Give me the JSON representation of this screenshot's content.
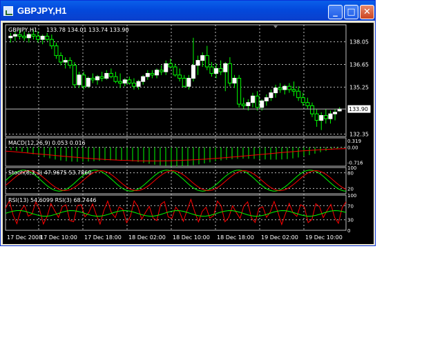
{
  "window": {
    "title": "GBPJPY,H1",
    "buttons": {
      "minimize": "_",
      "maximize": "□",
      "close": "✕"
    }
  },
  "colors": {
    "background": "#000000",
    "grid": "#C0C0C0",
    "bull_candle": "#FFFFFF",
    "wick": "#00FF00",
    "macd_histogram": "#00FF00",
    "macd_signal": "#FF0000",
    "stoch_main": "#00FF00",
    "stoch_signal": "#FF0000",
    "rsi_fast": "#FF0000",
    "rsi_slow": "#00FF00",
    "text": "#FFFFFF",
    "titlebar": "#0A5FEA"
  },
  "chart_data": [
    {
      "type": "candlestick",
      "title": "GBPJPY,H1",
      "ohlc_label": "133.78 134.01 133.74 133.90",
      "yticks": [
        "138.05",
        "136.65",
        "135.25",
        "132.35"
      ],
      "ylim": [
        132.2,
        139.1
      ],
      "current_price": 133.9,
      "current_price_label": "133.90",
      "xticks": [
        "17 Dec 2008",
        "17 Dec 10:00",
        "17 Dec 18:00",
        "18 Dec 02:00",
        "18 Dec 10:00",
        "18 Dec 18:00",
        "19 Dec 02:00",
        "19 Dec 10:00"
      ],
      "series": [
        {
          "values": [
            [
              138.3,
              138.6,
              138.0,
              138.4
            ],
            [
              138.4,
              138.7,
              138.1,
              138.5
            ],
            [
              138.5,
              138.8,
              138.2,
              138.4
            ],
            [
              138.4,
              138.7,
              138.1,
              138.3
            ],
            [
              138.3,
              138.6,
              138.0,
              138.5
            ],
            [
              138.5,
              138.8,
              138.2,
              138.4
            ],
            [
              138.4,
              138.7,
              138.0,
              138.2
            ],
            [
              138.2,
              138.5,
              137.9,
              138.4
            ],
            [
              138.4,
              138.6,
              138.1,
              138.2
            ],
            [
              138.2,
              138.5,
              137.6,
              137.8
            ],
            [
              137.8,
              138.0,
              137.0,
              137.2
            ],
            [
              137.2,
              137.4,
              136.6,
              136.8
            ],
            [
              136.8,
              137.1,
              136.4,
              136.9
            ],
            [
              136.9,
              137.1,
              136.4,
              136.6
            ],
            [
              136.6,
              136.8,
              135.2,
              135.4
            ],
            [
              135.4,
              136.2,
              135.2,
              136.0
            ],
            [
              136.0,
              136.2,
              135.1,
              135.3
            ],
            [
              135.3,
              135.9,
              135.2,
              135.8
            ],
            [
              135.8,
              136.1,
              135.5,
              135.7
            ],
            [
              135.7,
              136.0,
              135.4,
              135.9
            ],
            [
              135.9,
              136.2,
              135.6,
              135.8
            ],
            [
              135.8,
              136.3,
              135.7,
              136.1
            ],
            [
              136.1,
              136.4,
              135.8,
              135.9
            ],
            [
              135.9,
              136.2,
              135.5,
              135.6
            ],
            [
              135.6,
              136.1,
              135.2,
              135.5
            ],
            [
              135.5,
              135.8,
              135.3,
              135.7
            ],
            [
              135.7,
              135.9,
              135.4,
              135.5
            ],
            [
              135.5,
              135.8,
              135.1,
              135.3
            ],
            [
              135.3,
              135.7,
              135.1,
              135.6
            ],
            [
              135.6,
              136.0,
              135.4,
              135.9
            ],
            [
              135.9,
              136.3,
              135.7,
              136.1
            ],
            [
              136.1,
              136.3,
              135.8,
              136.0
            ],
            [
              136.0,
              136.4,
              135.8,
              136.3
            ],
            [
              136.3,
              136.6,
              136.0,
              136.2
            ],
            [
              136.2,
              136.9,
              136.0,
              136.7
            ],
            [
              136.7,
              137.0,
              136.4,
              136.5
            ],
            [
              136.5,
              136.7,
              135.9,
              136.0
            ],
            [
              136.0,
              136.4,
              135.6,
              135.8
            ],
            [
              135.8,
              136.0,
              135.2,
              135.3
            ],
            [
              135.3,
              136.0,
              135.1,
              135.8
            ],
            [
              135.8,
              138.3,
              135.6,
              136.6
            ],
            [
              136.6,
              137.2,
              136.0,
              136.9
            ],
            [
              136.9,
              137.4,
              136.5,
              137.2
            ],
            [
              137.2,
              137.8,
              136.3,
              136.5
            ],
            [
              136.5,
              136.8,
              135.9,
              136.1
            ],
            [
              136.1,
              136.7,
              135.8,
              136.4
            ],
            [
              136.4,
              136.9,
              136.0,
              136.2
            ],
            [
              136.2,
              136.8,
              135.0,
              136.7
            ],
            [
              136.7,
              137.1,
              135.3,
              135.5
            ],
            [
              135.5,
              136.0,
              135.2,
              135.8
            ],
            [
              135.8,
              136.0,
              134.0,
              134.2
            ],
            [
              134.2,
              134.6,
              133.9,
              134.1
            ],
            [
              134.1,
              134.5,
              133.8,
              134.3
            ],
            [
              134.3,
              134.9,
              134.0,
              134.7
            ],
            [
              134.7,
              135.0,
              133.8,
              134.0
            ],
            [
              134.0,
              134.5,
              133.8,
              134.4
            ],
            [
              134.4,
              134.8,
              134.1,
              134.6
            ],
            [
              134.6,
              135.1,
              134.4,
              134.9
            ],
            [
              134.9,
              135.4,
              134.6,
              135.2
            ],
            [
              135.2,
              135.5,
              134.9,
              135.1
            ],
            [
              135.1,
              135.4,
              134.8,
              135.3
            ],
            [
              135.3,
              135.5,
              134.9,
              135.1
            ],
            [
              135.1,
              135.6,
              134.7,
              135.0
            ],
            [
              135.0,
              135.3,
              134.4,
              134.6
            ],
            [
              134.6,
              134.9,
              134.1,
              134.3
            ],
            [
              134.3,
              134.6,
              133.9,
              134.1
            ],
            [
              134.1,
              134.3,
              133.4,
              133.6
            ],
            [
              133.6,
              133.9,
              132.8,
              133.2
            ],
            [
              133.2,
              133.7,
              132.6,
              133.5
            ],
            [
              133.5,
              133.9,
              133.0,
              133.3
            ],
            [
              133.3,
              133.8,
              133.0,
              133.6
            ],
            [
              133.6,
              133.9,
              133.2,
              133.7
            ],
            [
              133.78,
              134.01,
              133.74,
              133.9
            ]
          ]
        }
      ]
    },
    {
      "type": "bar",
      "title": "MACD(12,26,9) 0.053 0.016",
      "yticks": [
        "0.319",
        "0.00",
        "-0.716"
      ],
      "ylim": [
        -0.9,
        0.45
      ]
    },
    {
      "type": "line",
      "title": "Stoch(8,3,3) 47.9675 53.7860",
      "yticks": [
        "100",
        "80",
        "20"
      ],
      "ylim": [
        0,
        100
      ]
    },
    {
      "type": "line",
      "title": "RSI(13) 54.6099  RSI(3) 68.7446",
      "yticks": [
        "100",
        "70",
        "30",
        "0"
      ],
      "ylim": [
        0,
        100
      ]
    }
  ]
}
